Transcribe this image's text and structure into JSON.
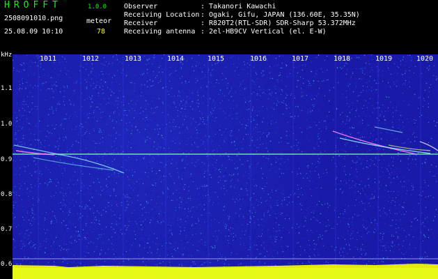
{
  "header": {
    "app_title": "HROFFT",
    "app_version": "1.0.0",
    "file_name": "2508091010.png",
    "meteor_label": "meteor",
    "date_time": "25.08.09 10:10",
    "meteor_count": "78"
  },
  "info": [
    {
      "label": "Observer",
      "value": ": Takanori Kawachi"
    },
    {
      "label": "Receiving Location",
      "value": ": Ogaki, Gifu, JAPAN (136.60E, 35.35N)"
    },
    {
      "label": "Receiver",
      "value": ": R820T2(RTL-SDR) SDR-Sharp 53.372MHz"
    },
    {
      "label": "Receiving antenna",
      "value": ": 2el-HB9CV Vertical (el. E-W)"
    }
  ],
  "axis": {
    "y_unit": "kHz",
    "y_ticks": [
      "1.1",
      "1.0",
      "0.9",
      "0.8",
      "0.7",
      "0.6"
    ],
    "x_ticks": [
      "1011",
      "1012",
      "1013",
      "1014",
      "1015",
      "1016",
      "1017",
      "1018",
      "1019",
      "1020"
    ]
  },
  "colors": {
    "title_green": "#00ff00",
    "count_yellow": "#ffff00",
    "background_blue": "#1a1aa8",
    "carrier_line": "#7fff9f"
  }
}
